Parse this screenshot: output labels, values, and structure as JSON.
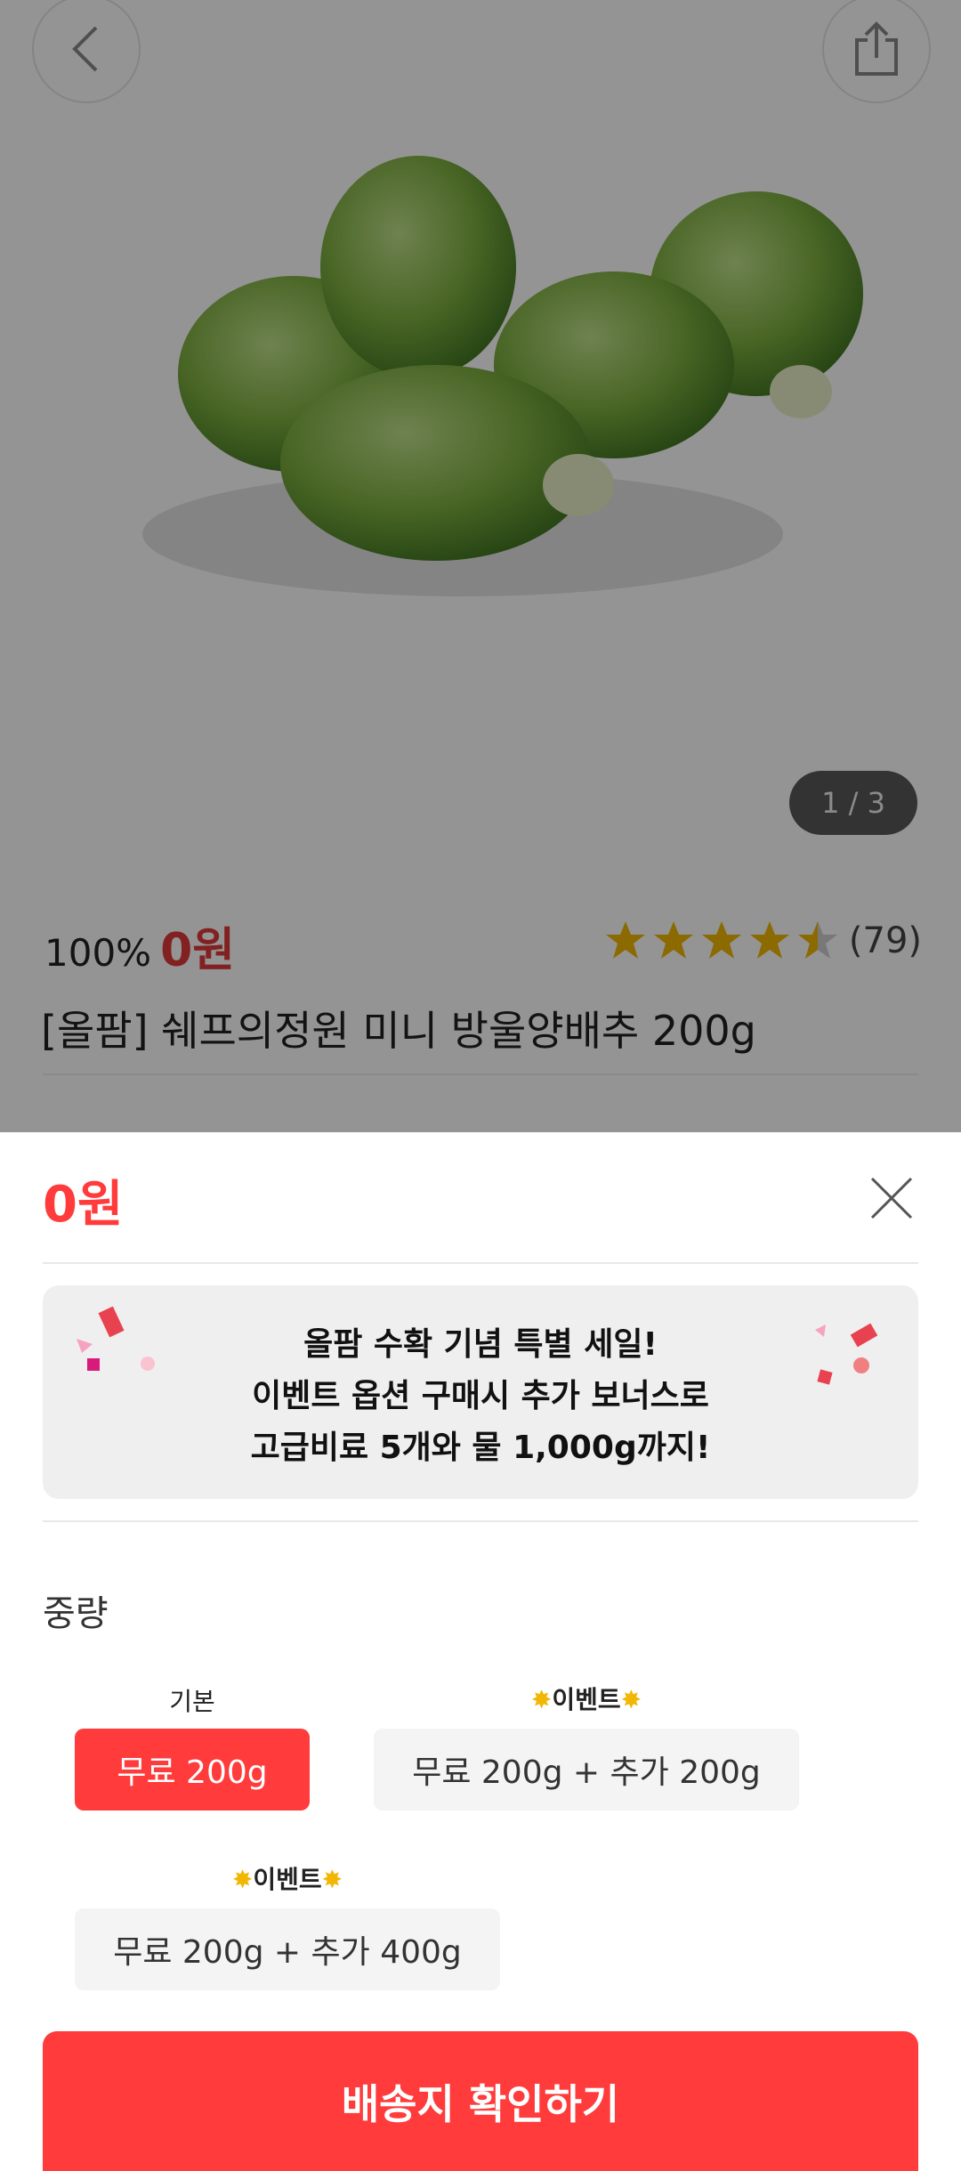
{
  "hero": {
    "image_counter": "1 / 3"
  },
  "product": {
    "discount": "100%",
    "price": "0원",
    "rating": 4.5,
    "review_count": "(79)",
    "title": "[올팜] 쉐프의정원 미니 방울양배추 200g"
  },
  "sheet": {
    "price": "0원",
    "banner": {
      "line1": "올팜 수확 기념 특별 세일!",
      "line2": "이벤트 옵션 구매시 추가 보너스로",
      "line3": "고급비료 5개와 물 1,000g까지!"
    },
    "section_label": "중량",
    "options": [
      {
        "caption": "기본",
        "label": "무료 200g",
        "selected": true
      },
      {
        "caption": "이벤트",
        "label": "무료 200g + 추가 200g",
        "selected": false
      },
      {
        "caption": "이벤트",
        "label": "무료 200g + 추가 400g",
        "selected": false
      }
    ],
    "cta_label": "배송지 확인하기"
  },
  "colors": {
    "accent": "#ff3b3b",
    "star": "#f2b705"
  }
}
